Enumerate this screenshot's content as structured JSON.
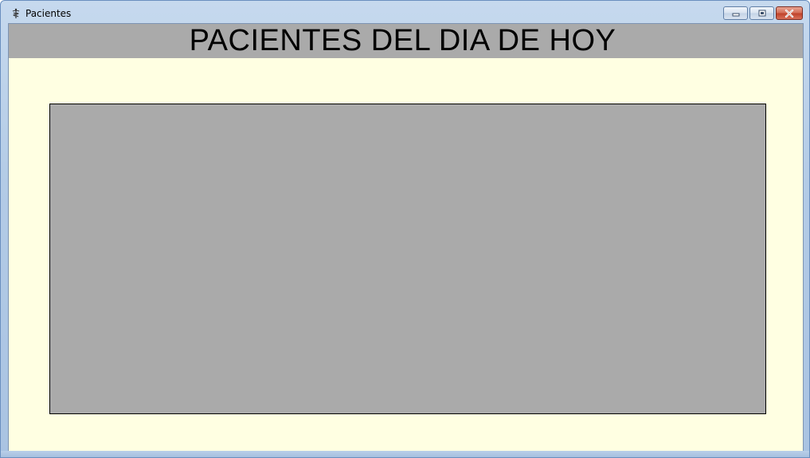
{
  "window": {
    "title": "Pacientes",
    "app_icon": "caduceus-icon",
    "controls": {
      "minimize_icon": "minimize-icon",
      "maximize_icon": "maximize-icon",
      "close_icon": "close-icon"
    }
  },
  "header": {
    "title": "PACIENTES DEL DIA DE HOY"
  },
  "colors": {
    "client_background": "#ffffe2",
    "header_band": "#aaaaaa",
    "grid_background": "#aaaaaa",
    "close_button": "#c8503a"
  }
}
